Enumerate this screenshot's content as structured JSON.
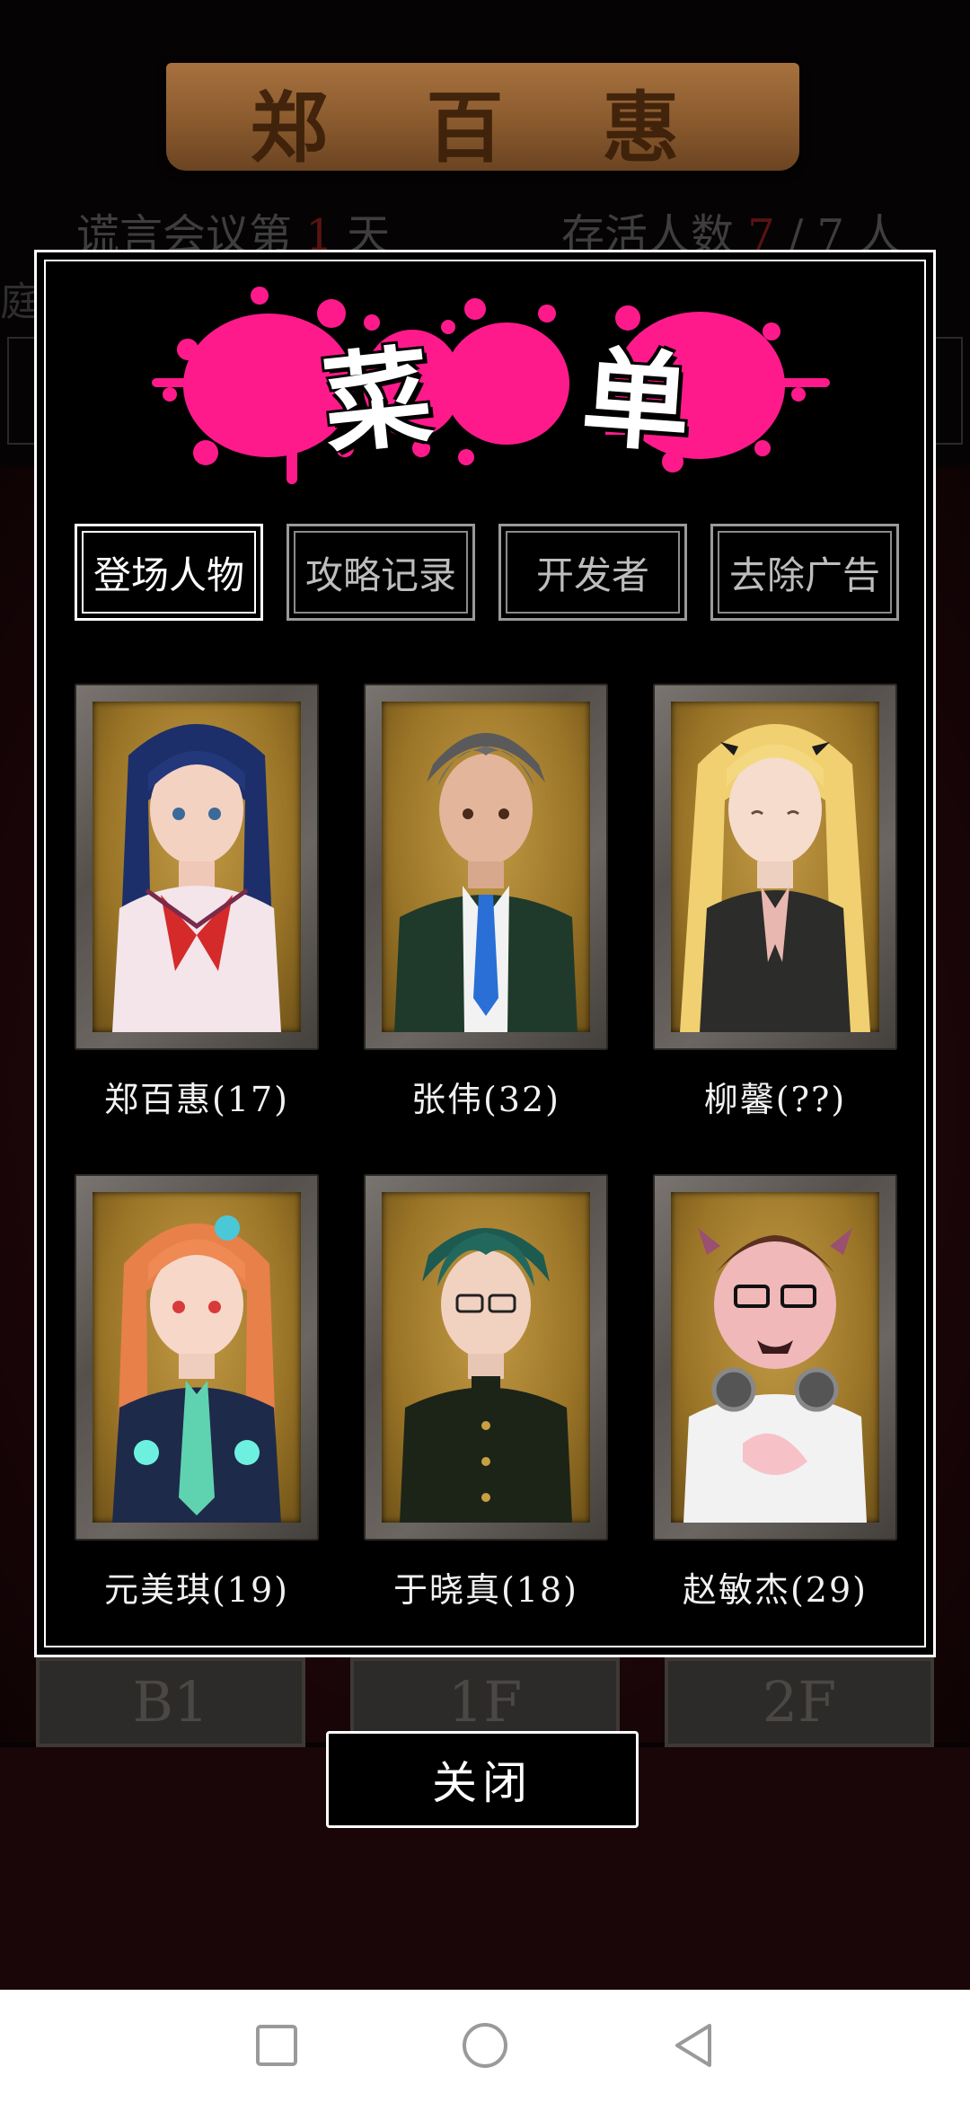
{
  "background": {
    "banner_text": "郑 百 惠",
    "meeting_prefix": "谎言会议第",
    "meeting_day": "1",
    "meeting_suffix": "天",
    "alive_label": "存活人数",
    "alive_current": "7",
    "alive_total": "/ 7 人",
    "side_text": "庭的",
    "floors": [
      "B1",
      "1F",
      "2F"
    ]
  },
  "menu": {
    "title_chars": [
      "菜",
      "单"
    ],
    "title_color": "#ff1a8c",
    "tabs": [
      {
        "label": "登场人物",
        "active": true
      },
      {
        "label": "攻略记录",
        "active": false
      },
      {
        "label": "开发者",
        "active": false
      },
      {
        "label": "去除广告",
        "active": false
      }
    ],
    "characters": [
      {
        "name": "郑百惠(17)"
      },
      {
        "name": "张伟(32)"
      },
      {
        "name": "柳馨(??)"
      },
      {
        "name": "元美琪(19)"
      },
      {
        "name": "于晓真(18)"
      },
      {
        "name": "赵敏杰(29)"
      }
    ],
    "close_label": "关闭"
  },
  "navbar": {
    "icons": [
      "recent-apps-icon",
      "home-icon",
      "back-icon"
    ]
  }
}
